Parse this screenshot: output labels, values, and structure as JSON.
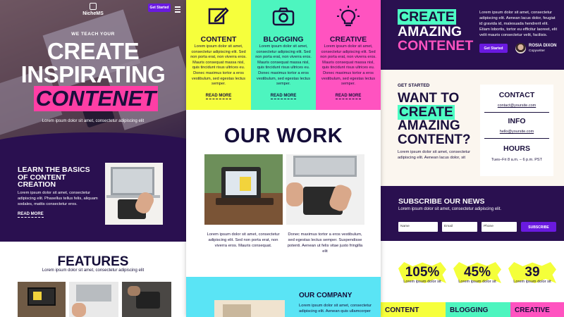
{
  "left": {
    "brand": "NicheMS",
    "cta_button": "Get Started",
    "hero": {
      "eyebrow": "WE TEACH YOUR",
      "line1": "CREATE",
      "line2": "INSPIRATING",
      "line3": "CONTENET",
      "subtitle": "Lorem ipsum dolor sit amet, consectetur adipiscing elit"
    },
    "learn": {
      "title": "LEARN THE BASICS OF CONTENT CREATION",
      "body": "Lorem ipsum dolor sit amet, consectetur adipiscing elit. Phasellus tellus felis, aliquam sodales, mattis consectetur eros.",
      "read_more": "READ MORE"
    },
    "features": {
      "title": "FEATURES",
      "subtitle": "Lorem ipsum dolor sit amet, consectetur adipiscing elit"
    }
  },
  "middle": {
    "cards": [
      {
        "title": "CONTENT",
        "icon": "edit-icon",
        "color": "#f6ff3c",
        "text": "Lorem ipsum dolor sit amet, consectetur adipiscing elit. Sed non porta erat, non viverra eros. Mauris consequat massa nisl, quis tincidunt risus ultrices eu. Donec maximus tortor a eros vestibulum, sed egestas lectus semper.",
        "read_more": "READ MORE"
      },
      {
        "title": "BLOGGING",
        "icon": "camera-icon",
        "color": "#4df5bf",
        "text": "Lorem ipsum dolor sit amet, consectetur adipiscing elit. Sed non porta erat, non viverra eros. Mauris consequat massa nisl, quis tincidunt risus ultrices eu. Donec maximus tortor a eros vestibulum, sed egestas lectus semper.",
        "read_more": "READ MORE"
      },
      {
        "title": "CREATIVE",
        "icon": "lightbulb-icon",
        "color": "#ff53c0",
        "text": "Lorem ipsum dolor sit amet, consectetur adipiscing elit. Sed non porta erat, non viverra eros. Mauris consequat massa nisl, quis tincidunt risus ultrices eu. Donec maximus tortor a eros vestibulum, sed egestas lectus semper.",
        "read_more": "READ MORE"
      }
    ],
    "our_work": {
      "title": "OUR WORK",
      "left_text": "Lorem ipsum dolor sit amet, consectetur adipiscing elit. Sed non porta erat, non viverra eros. Mauris consequat.",
      "right_text": "Donec maximus tortor a eros vestibulum, sed egestas lectus semper. Suspendisse potenti. Aenean ut felis vitae justo fringilla elit"
    },
    "company": {
      "title": "OUR COMPANY",
      "text": "Lorem ipsum dolor sit amet, consectetur adipiscing elit. Aenean quis ullamcorper"
    }
  },
  "right": {
    "create": {
      "line1": "CREATE",
      "line2": "AMAZING",
      "line3": "CONTENET"
    },
    "paragraph": "Lorem ipsum dolor sit amet, consectetur adipiscing elit. Aenean lacus dolor, feugiat id gravida id, malesuada hendrerit elit. Etiam lobortis, tortor eu efficitur laoreet, elit velit mauris consectetur velit, facilisis.",
    "cta_button": "Get Started",
    "person": {
      "name": "ROSIA DIXON",
      "role": "Copywriter"
    },
    "get_started_label": "GET STARTED",
    "want": {
      "line1": "WANT TO",
      "line2": "CREATE",
      "line3": "AMAZING",
      "line4": "CONTENT?"
    },
    "want_sub": "Lorem ipsum dolor sit amet, consectetur adipiscing elit. Aenean lacus dolor, sit",
    "contact": {
      "contact_label": "CONTACT",
      "contact_email": "contact@yoursite.com",
      "info_label": "INFO",
      "info_email": "hello@yoursite.com",
      "hours_label": "HOURS",
      "hours_value": "Tues–Fri 8 a.m. – 6 p.m. PST"
    },
    "newsletter": {
      "title": "SUBSCRIBE OUR NEWS",
      "subtitle": "Lorem ipsum dolor sit amet, consectetur adipiscing elit.",
      "name_placeholder": "Name",
      "email_placeholder": "Email",
      "phone_placeholder": "Phone",
      "button": "SUBSCRIBE"
    },
    "stats": [
      {
        "value": "105%",
        "label": "Lorem ipsum dolor sit"
      },
      {
        "value": "45%",
        "label": "Lorem ipsum dolor sit"
      },
      {
        "value": "39",
        "label": "Lorem ipsum dolor sit"
      }
    ],
    "tabs": [
      {
        "label": "CONTENT",
        "color": "#f6ff3c"
      },
      {
        "label": "BLOGGING",
        "color": "#4df5bf"
      },
      {
        "label": "CREATIVE",
        "color": "#ff53c0"
      }
    ]
  }
}
